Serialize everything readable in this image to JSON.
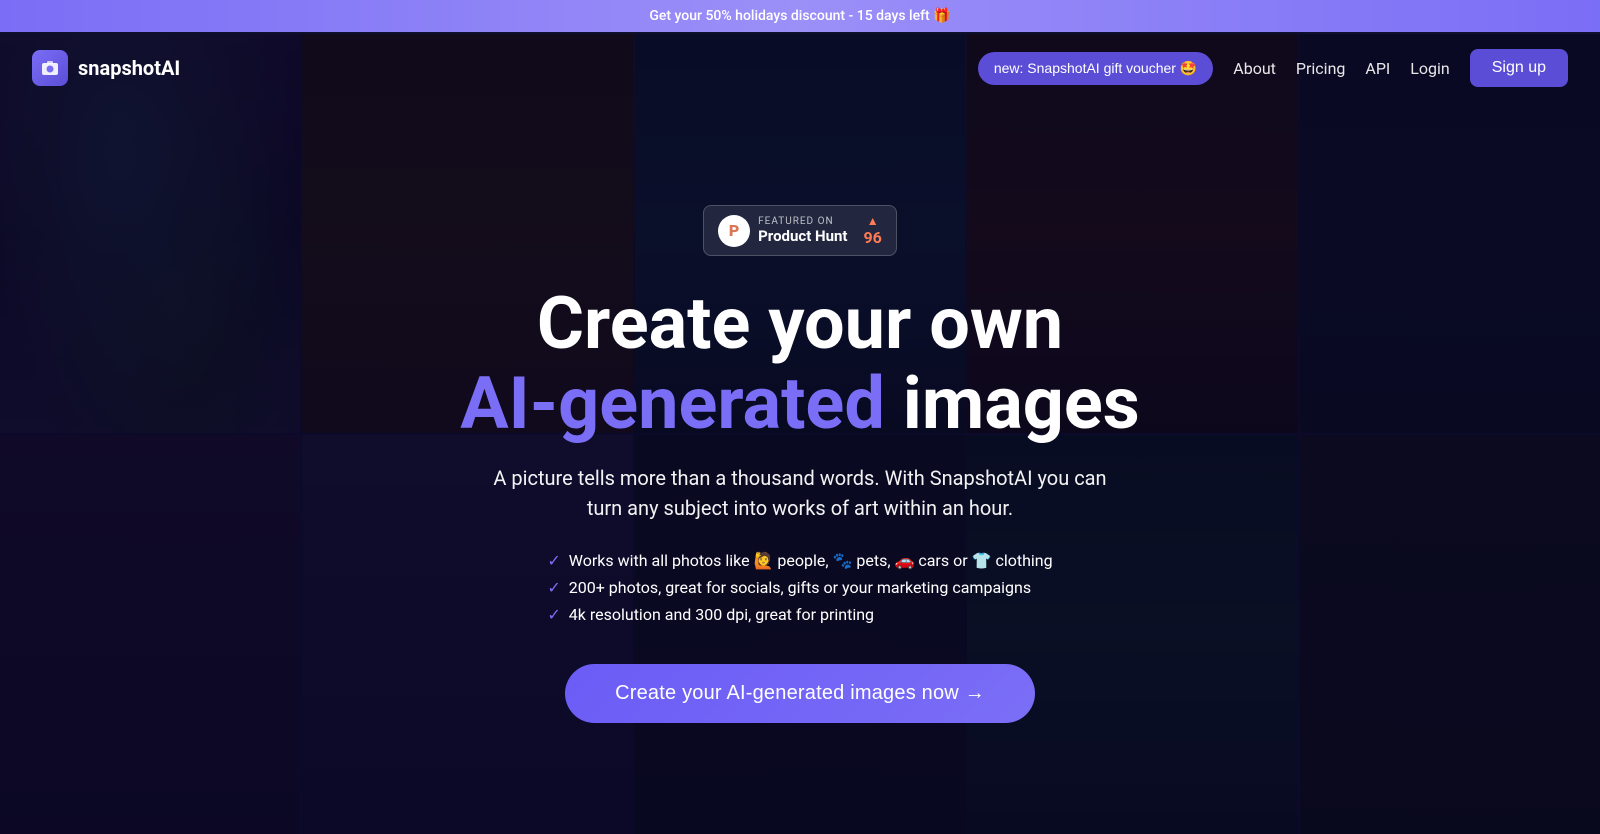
{
  "banner": {
    "text": "Get your 50% holidays discount - 15 days left 🎁"
  },
  "navbar": {
    "logo_text": "snapshotAI",
    "logo_icon": "📷",
    "gift_voucher": "new: SnapshotAI gift voucher 🤩",
    "links": [
      {
        "label": "About",
        "id": "about"
      },
      {
        "label": "Pricing",
        "id": "pricing"
      },
      {
        "label": "API",
        "id": "api"
      },
      {
        "label": "Login",
        "id": "login"
      }
    ],
    "signup": "Sign up"
  },
  "product_hunt": {
    "featured_label": "FEATURED ON",
    "name": "Product Hunt",
    "score": "96",
    "triangle": "▲"
  },
  "hero": {
    "title_line1": "Create your own",
    "title_ai": "AI-generated",
    "title_line2": "images",
    "subtitle": "A picture tells more than a thousand words. With SnapshotAI you can turn any subject into works of art within an hour.",
    "features": [
      "Works with all photos like 🙋 people, 🐾 pets, 🚗 cars or 👕 clothing",
      "200+ photos, great for socials, gifts or your marketing campaigns",
      "4k resolution and 300 dpi, great for printing"
    ],
    "cta": "Create your AI-generated images now →"
  }
}
